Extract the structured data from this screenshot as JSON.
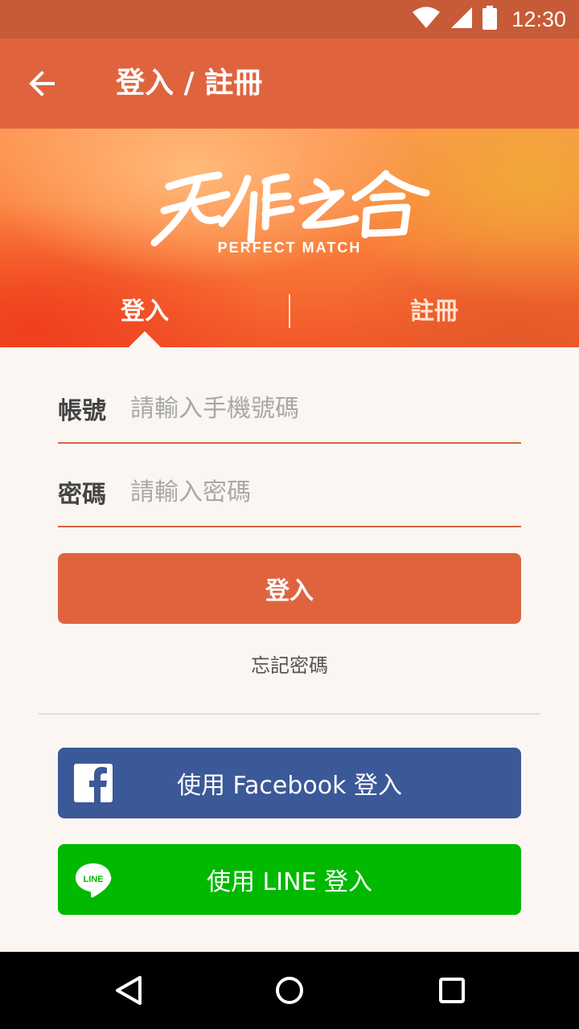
{
  "status_bar": {
    "time": "12:30",
    "icons": [
      "wifi-icon",
      "cell-signal-icon",
      "battery-icon"
    ]
  },
  "app_bar": {
    "title": "登入 / 註冊",
    "back_icon": "arrow-left-icon"
  },
  "hero": {
    "logo_text": "天作之合",
    "tagline": "PERFECT MATCH",
    "tabs": [
      {
        "label": "登入",
        "active": true
      },
      {
        "label": "註冊",
        "active": false
      }
    ]
  },
  "form": {
    "account": {
      "label": "帳號",
      "placeholder": "請輸入手機號碼",
      "value": ""
    },
    "password": {
      "label": "密碼",
      "placeholder": "請輸入密碼",
      "value": ""
    },
    "submit_label": "登入",
    "forgot_label": "忘記密碼"
  },
  "social": {
    "facebook": {
      "label": "使用 Facebook 登入",
      "icon": "facebook-icon",
      "color": "#3b5998"
    },
    "line": {
      "label": "使用 LINE 登入",
      "icon": "line-icon",
      "icon_text": "LINE",
      "color": "#00b900"
    }
  },
  "colors": {
    "accent": "#df643e",
    "status_bar": "#c75a37",
    "background": "#fbf6f2"
  },
  "nav_bar": {
    "icons": [
      "back-triangle-icon",
      "home-circle-icon",
      "recents-square-icon"
    ]
  }
}
